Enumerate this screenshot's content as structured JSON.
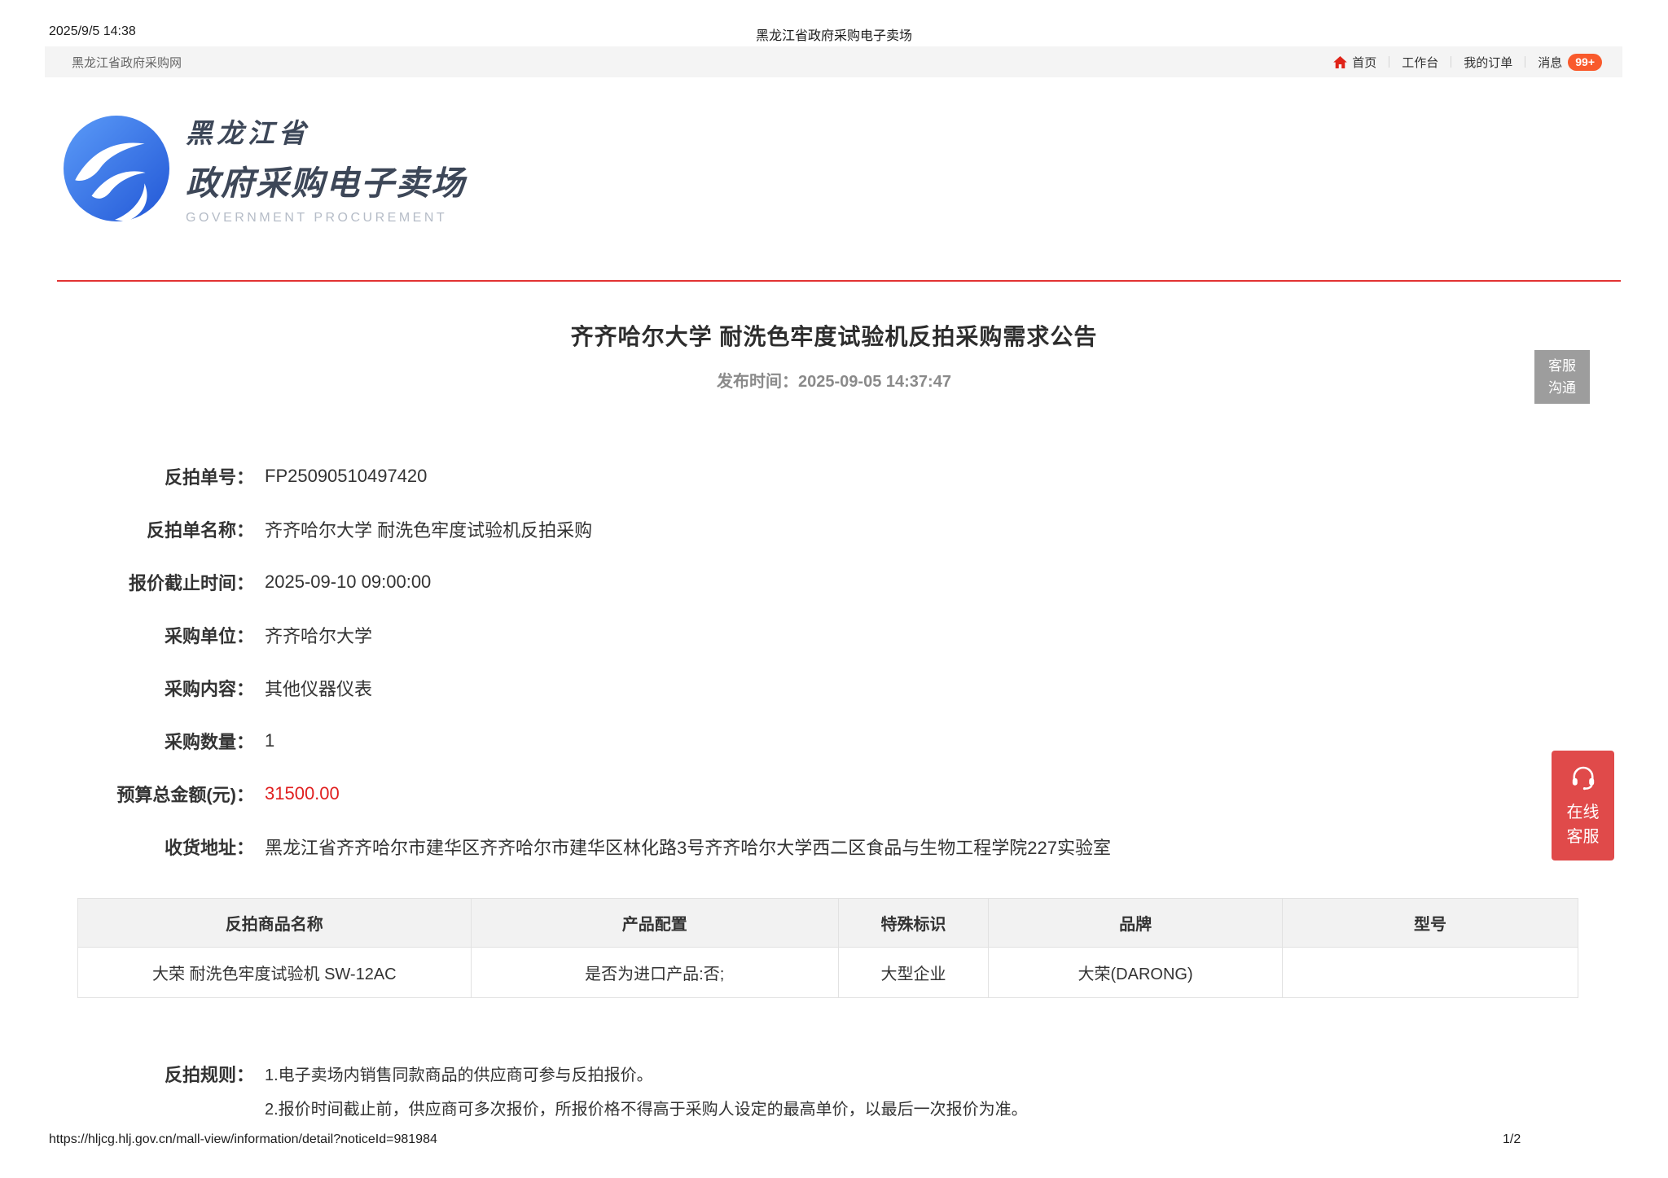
{
  "print_header": {
    "timestamp": "2025/9/5 14:38",
    "doc_title": "黑龙江省政府采购电子卖场"
  },
  "navbar": {
    "site_name": "黑龙江省政府采购网",
    "items": [
      {
        "label": "首页"
      },
      {
        "label": "工作台"
      },
      {
        "label": "我的订单"
      },
      {
        "label": "消息"
      }
    ],
    "message_badge": "99+"
  },
  "logo": {
    "line1": "黑龙江省",
    "line2": "政府采购电子卖场",
    "subtitle": "GOVERNMENT PROCUREMENT"
  },
  "notice": {
    "title": "齐齐哈尔大学 耐洗色牢度试验机反拍采购需求公告",
    "publish_label": "发布时间：",
    "publish_time": "2025-09-05 14:37:47"
  },
  "service_button": {
    "line1": "客服",
    "line2": "沟通"
  },
  "online_service": {
    "line1": "在线",
    "line2": "客服"
  },
  "fields": [
    {
      "label": "反拍单号：",
      "value": "FP25090510497420"
    },
    {
      "label": "反拍单名称：",
      "value": "齐齐哈尔大学 耐洗色牢度试验机反拍采购"
    },
    {
      "label": "报价截止时间：",
      "value": "2025-09-10 09:00:00"
    },
    {
      "label": "采购单位：",
      "value": "齐齐哈尔大学"
    },
    {
      "label": "采购内容：",
      "value": "其他仪器仪表"
    },
    {
      "label": "采购数量：",
      "value": "1"
    },
    {
      "label": "预算总金额(元)：",
      "value": "31500.00"
    },
    {
      "label": "收货地址：",
      "value": "黑龙江省齐齐哈尔市建华区齐齐哈尔市建华区林化路3号齐齐哈尔大学西二区食品与生物工程学院227实验室"
    }
  ],
  "table": {
    "headers": [
      "反拍商品名称",
      "产品配置",
      "特殊标识",
      "品牌",
      "型号"
    ],
    "rows": [
      [
        "大荣 耐洗色牢度试验机 SW-12AC",
        "是否为进口产品:否;",
        "大型企业",
        "大荣(DARONG)",
        ""
      ]
    ]
  },
  "rules": {
    "label": "反拍规则：",
    "items": [
      "1.电子卖场内销售同款商品的供应商可参与反拍报价。",
      "2.报价时间截止前，供应商可多次报价，所报价格不得高于采购人设定的最高单价，以最后一次报价为准。"
    ]
  },
  "print_footer": {
    "url": "https://hljcg.hlj.gov.cn/mall-view/information/detail?noticeId=981984",
    "page": "1/2"
  },
  "colors": {
    "brand_blue": "#2f6bdf",
    "divider_red": "#e23333",
    "budget_red": "#e01f1f",
    "badge_orange": "#f95a2c",
    "home_icon_red": "#e02318",
    "service_gray": "#9d9d9d",
    "online_service_red": "#e04a4a",
    "navbar_bg": "#f4f4f4",
    "table_header_bg": "#f2f2f2"
  }
}
